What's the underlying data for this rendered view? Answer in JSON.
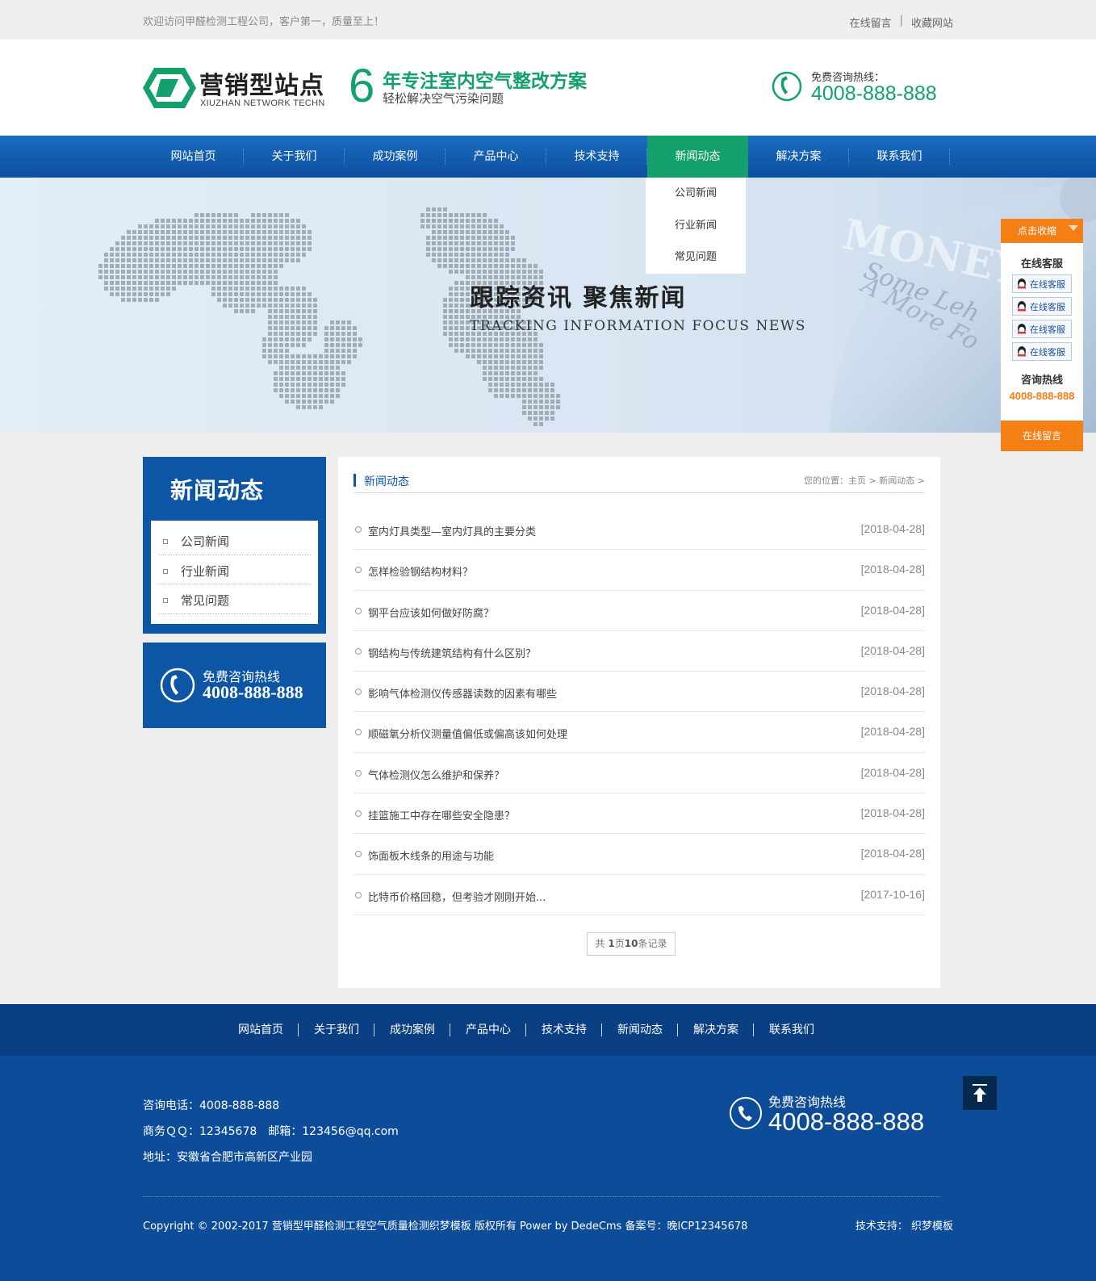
{
  "topbar": {
    "welcome": "欢迎访问甲醛检测工程公司，客户第一，质量至上！",
    "links": [
      "在线留言",
      "收藏网站"
    ],
    "separator": "|"
  },
  "header": {
    "logo_text": "营销型站点",
    "logo_sub": "XIUZHAN NETWORK TECHN",
    "slogan_number": "6",
    "slogan_line1": "年专注室内空气整改方案",
    "slogan_line2": "轻松解决空气污染问题",
    "hotline_label": "免费咨询热线：",
    "hotline_number": "4008-888-888",
    "accent_color": "#14a06b"
  },
  "nav": {
    "items": [
      "网站首页",
      "关于我们",
      "成功案例",
      "产品中心",
      "技术支持",
      "新闻动态",
      "解决方案",
      "联系我们"
    ],
    "active_index": 5,
    "submenu": [
      "公司新闻",
      "行业新闻",
      "常见问题"
    ]
  },
  "banner": {
    "title": "跟踪资讯  聚焦新闻",
    "subtitle": "TRACKING INFORMATION FOCUS NEWS"
  },
  "float": {
    "head": "点击收缩",
    "title": "在线客服",
    "qq_items": [
      "在线客服",
      "在线客服",
      "在线客服",
      "在线客服"
    ],
    "hotline_title": "咨询热线",
    "hotline_number": "4008-888-888",
    "foot": "在线留言",
    "accent_color": "#f47f14"
  },
  "sidebar": {
    "title": "新闻动态",
    "items": [
      "公司新闻",
      "行业新闻",
      "常见问题"
    ],
    "call_label": "免费咨询热线",
    "call_number": "4008-888-888"
  },
  "main": {
    "title": "新闻动态",
    "breadcrumb": "您的位置：主页 > 新闻动态 >",
    "articles": [
      {
        "title": "室内灯具类型—室内灯具的主要分类",
        "date": "[2018-04-28]"
      },
      {
        "title": "怎样检验钢结构材料？",
        "date": "[2018-04-28]"
      },
      {
        "title": "钢平台应该如何做好防腐？",
        "date": "[2018-04-28]"
      },
      {
        "title": "钢结构与传统建筑结构有什么区别？",
        "date": "[2018-04-28]"
      },
      {
        "title": "影响气体检测仪传感器读数的因素有哪些",
        "date": "[2018-04-28]"
      },
      {
        "title": "顺磁氧分析仪测量值偏低或偏高该如何处理",
        "date": "[2018-04-28]"
      },
      {
        "title": "气体检测仪怎么维护和保养？",
        "date": "[2018-04-28]"
      },
      {
        "title": "挂篮施工中存在哪些安全隐患？",
        "date": "[2018-04-28]"
      },
      {
        "title": "饰面板木线条的用途与功能",
        "date": "[2018-04-28]"
      },
      {
        "title": "比特币价格回稳，但考验才刚刚开始...",
        "date": "[2017-10-16]"
      }
    ],
    "pager": {
      "prefix": "共 ",
      "pages": "1",
      "mid": "页",
      "records": "10",
      "suffix": "条记录"
    }
  },
  "footer": {
    "nav": [
      "网站首页",
      "关于我们",
      "成功案例",
      "产品中心",
      "技术支持",
      "新闻动态",
      "解决方案",
      "联系我们"
    ],
    "phone": "咨询电话：4008-888-888",
    "qq_email": "商务ＱＱ：12345678　邮箱：123456@qq.com",
    "address": "地址：安徽省合肥市高新区产业园",
    "hotline_label": "免费咨询热线",
    "hotline_number": "4008-888-888",
    "copyright": "Copyright © 2002-2017 营销型甲醛检测工程空气质量检测织梦模板 版权所有 Power by DedeCms   备案号：晚ICP12345678",
    "support": "技术支持： 织梦模板"
  }
}
